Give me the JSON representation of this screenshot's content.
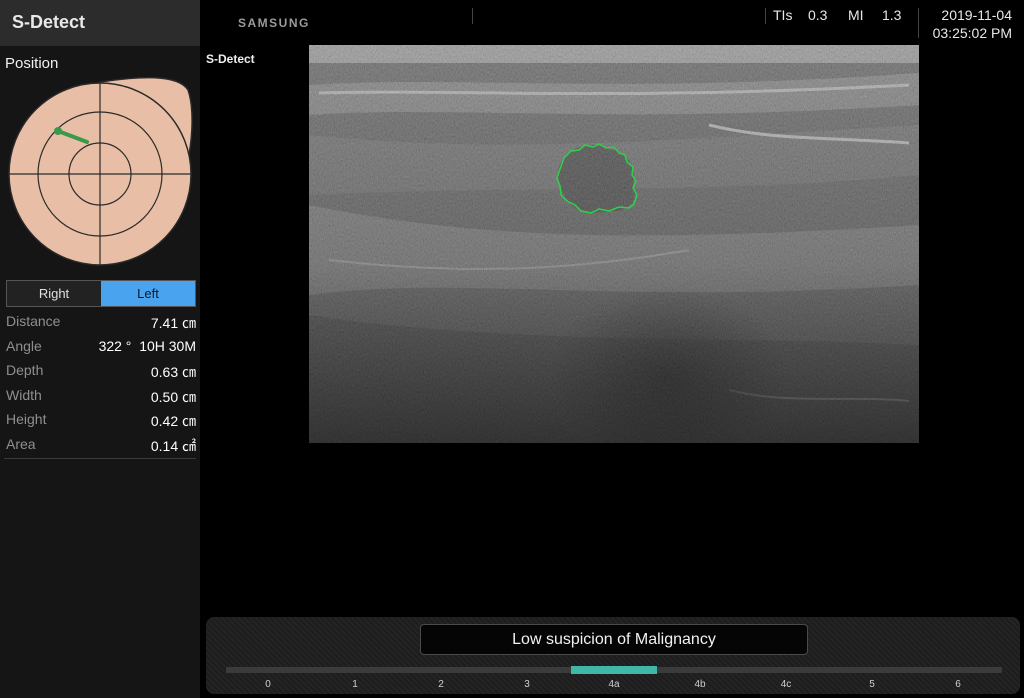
{
  "app": {
    "title": "S-Detect",
    "brand": "SAMSUNG"
  },
  "top_info": {
    "tis_label": "TIs",
    "tis_value": "0.3",
    "mi_label": "MI",
    "mi_value": "1.3",
    "date": "2019-11-04",
    "time": "03:25:02 PM"
  },
  "position": {
    "label": "Position",
    "side_options": [
      "Right",
      "Left"
    ],
    "selected_side": "Left"
  },
  "measurements": [
    {
      "label": "Distance",
      "value": "7.41 ㎝"
    },
    {
      "label": "Angle",
      "value": "322 °  10H 30M"
    },
    {
      "label": "Depth",
      "value": "0.63 ㎝"
    },
    {
      "label": "Width",
      "value": "0.50 ㎝"
    },
    {
      "label": "Height",
      "value": "0.42 ㎝"
    },
    {
      "label": "Area",
      "value": "0.14 ㎠"
    }
  ],
  "image": {
    "mode_label": "S-Detect"
  },
  "result": {
    "text": "Low suspicion of Malignancy",
    "scale_ticks": [
      "0",
      "1",
      "2",
      "3",
      "4a",
      "4b",
      "4c",
      "5",
      "6"
    ],
    "selected_category": "4a"
  },
  "colors": {
    "accent_blue": "#4aa3ef",
    "marker_teal": "#3fb8a8",
    "lesion_outline": "#2fd14a",
    "probe_marker": "#3a9a4a",
    "breast_fill": "#e8bfa6"
  }
}
